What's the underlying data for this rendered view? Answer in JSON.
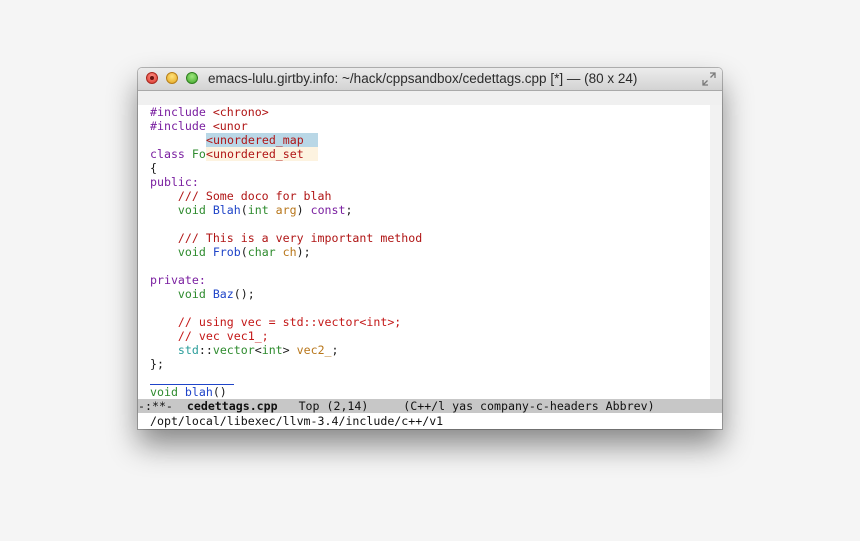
{
  "window": {
    "title": "emacs-lulu.girtby.info: ~/hack/cppsandbox/cedettags.cpp [*]  —  (80 x 24)"
  },
  "code": {
    "l1": {
      "a": "#include ",
      "b": "<chrono>"
    },
    "l2": {
      "a": "#include ",
      "b": "<unor"
    },
    "l4": {
      "a": "class ",
      "b": "Fo"
    },
    "l5": "{",
    "l6": "public:",
    "l7": "    /// Some doco for blah",
    "l8": {
      "indent": "    ",
      "t1": "void",
      "sp": " ",
      "fn": "Blah",
      "p1": "(",
      "t2": "int",
      "sp2": " ",
      "arg": "arg",
      "p2": ") ",
      "kw": "const",
      "end": ";"
    },
    "l10": "    /// This is a very important method",
    "l11": {
      "indent": "    ",
      "t1": "void",
      "sp": " ",
      "fn": "Frob",
      "p1": "(",
      "t2": "char",
      "sp2": " ",
      "arg": "ch",
      "end": ");"
    },
    "l13": "private:",
    "l14": {
      "indent": "    ",
      "t1": "void",
      "sp": " ",
      "fn": "Baz",
      "end": "();"
    },
    "l16": "    // using vec = std::vector<int>;",
    "l17": "    // vec vec1_;",
    "l18": {
      "indent": "    ",
      "ns": "std",
      "sep": "::",
      "ty": "vector",
      "lt": "<",
      "t": "int",
      "gt": ">",
      "sp": " ",
      "v": "vec2_",
      "end": ";"
    },
    "l19": "};",
    "l21": {
      "t1": "void",
      "sp": " ",
      "fn": "blah",
      "end": "()"
    }
  },
  "completion": {
    "items": [
      "<unordered_map",
      "<unordered_set"
    ]
  },
  "modeline": {
    "status": "-:**-  ",
    "buffer": "cedettags.cpp",
    "position": "   Top (2,14)     ",
    "modes": "(C++/l yas company-c-headers Abbrev)"
  },
  "echo_area": "/opt/local/libexec/llvm-3.4/include/c++/v1",
  "colors": {
    "keyword": "#7a1fa0",
    "type": "#2e8b2e",
    "function": "#1f44c8",
    "string": "#b01515",
    "variable": "#b8761a",
    "constant": "#2a9d9a",
    "completion_selected": "#b9d7e6",
    "completion_item": "#fdf3e0",
    "modeline_bg": "#c7c7c7"
  }
}
